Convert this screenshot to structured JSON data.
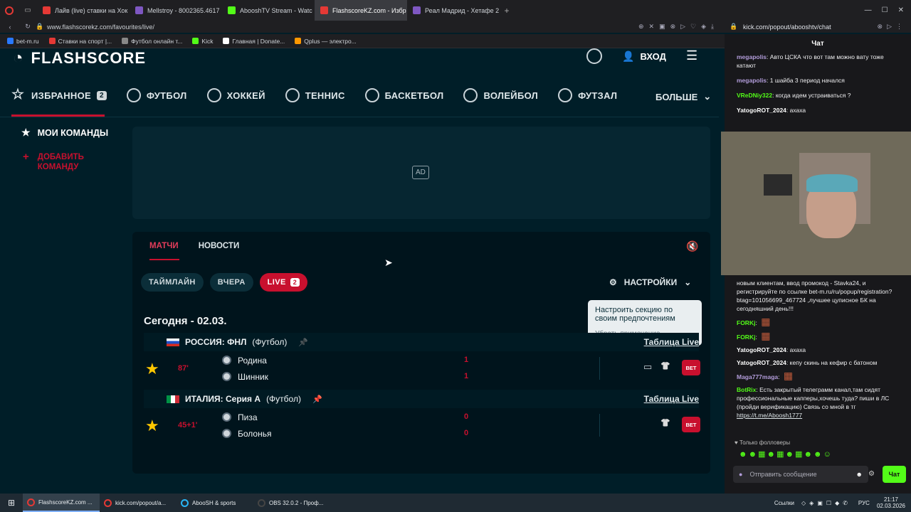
{
  "browser": {
    "tabs": [
      {
        "label": "Лайв (live) ставки на Хок",
        "color": "#e53935"
      },
      {
        "label": "Mellstroy - 8002365.4617",
        "color": "#7e57c2"
      },
      {
        "label": "AbooshTV Stream - Watc",
        "color": "#53fc18"
      },
      {
        "label": "FlashscoreKZ.com - Избр",
        "color": "#e53935"
      },
      {
        "label": "Реал Мадрид - Хетафе 2",
        "color": "#7e57c2"
      }
    ],
    "url": "www.flashscorekz.com/favourites/live/",
    "chat_url": "kick.com/popout/abooshtv/chat",
    "bookmarks": [
      {
        "label": "bet-m.ru",
        "color": "#2979ff"
      },
      {
        "label": "Ставки на спорт |...",
        "color": "#e53935"
      },
      {
        "label": "Футбол онлайн т...",
        "color": "#888888"
      },
      {
        "label": "Kick",
        "color": "#53fc18"
      },
      {
        "label": "Главная | Donate...",
        "color": "#ffffff"
      },
      {
        "label": "Qplus — электро...",
        "color": "#ff9800"
      }
    ]
  },
  "site": {
    "logo": "FLASHSCORE",
    "login": "ВХОД",
    "nav": [
      {
        "label": "ИЗБРАННОЕ",
        "badge": "2",
        "icon": "star-icon"
      },
      {
        "label": "ФУТБОЛ",
        "icon": "football-icon"
      },
      {
        "label": "ХОККЕЙ",
        "icon": "hockey-icon"
      },
      {
        "label": "ТЕННИС",
        "icon": "tennis-icon"
      },
      {
        "label": "БАСКЕТБОЛ",
        "icon": "basketball-icon"
      },
      {
        "label": "ВОЛЕЙБОЛ",
        "icon": "volleyball-icon"
      },
      {
        "label": "ФУТЗАЛ",
        "icon": "futsal-icon"
      }
    ],
    "more": "БОЛЬШЕ",
    "sidebar": {
      "my_teams": "МОИ КОМАНДЫ",
      "add_team": "ДОБАВИТЬ КОМАНДУ"
    },
    "ad_label": "AD",
    "tabs": [
      "МАТЧИ",
      "НОВОСТИ"
    ],
    "filters": [
      "ТАЙМЛАЙН",
      "ВЧЕРА",
      "LIVE"
    ],
    "live_count": "2",
    "settings": "НАСТРОЙКИ",
    "tooltip": {
      "text": "Настроить секцию по своим предпочтениям",
      "dismiss": "Убрать примечание"
    },
    "date": "Сегодня - 02.03.",
    "leagues": [
      {
        "name": "РОССИЯ: ФНЛ",
        "sport": "(Футбол)",
        "table": "Таблица Live",
        "match": {
          "minute": "87'",
          "home": "Родина",
          "away": "Шинник",
          "home_score": "1",
          "away_score": "1"
        }
      },
      {
        "name": "ИТАЛИЯ: Серия А",
        "sport": "(Футбол)",
        "table": "Таблица Live",
        "match": {
          "minute": "45+1'",
          "home": "Пиза",
          "away": "Болонья",
          "home_score": "0",
          "away_score": "0"
        }
      }
    ],
    "bet_label": "BET"
  },
  "chat": {
    "title": "Чат",
    "messages_top": [
      {
        "user": "megapolis",
        "text": "Авто ЦСКА что вот там можно вату тоже катают",
        "color": "#b39ddb"
      },
      {
        "user": "megapolis",
        "text": "1 шайба 3 период начался",
        "color": "#b39ddb"
      },
      {
        "user": "VReDNiy322",
        "text": "когда идем устраиваться ?",
        "color": "#53fc18"
      },
      {
        "user": "YatogoROT_2024",
        "text": "ахаха",
        "color": "#ffffff"
      }
    ],
    "messages_bottom": [
      {
        "user": "",
        "text": "новым клиентам, ввод промокод - Stavka24, и регистрируйте по ссылке bet-m.ru/ru/popup/registration?btag=101056699_467724 ,лучшее цуписное БК на сегодняшний день!!!",
        "color": "#ffffff"
      },
      {
        "user": "FORKj",
        "text": "",
        "color": "#53fc18"
      },
      {
        "user": "FORKj",
        "text": "",
        "color": "#53fc18"
      },
      {
        "user": "YatogoROT_2024",
        "text": "ахаха",
        "color": "#ffffff"
      },
      {
        "user": "YatogoROT_2024",
        "text": "кепу скинь на кефир с батоном",
        "color": "#ffffff"
      },
      {
        "user": "Maga777maga",
        "text": "",
        "color": "#b39ddb"
      },
      {
        "user": "BotRix",
        "text": "Есть закрытый телеграмм канал,там сидят профессиональные капперы,хочешь туда? пиши в ЛС (пройди верификацию) Связь со мной в тг ",
        "color": "#53fc18",
        "link": "https://t.me/Aboosh1777"
      }
    ],
    "followers_only": "Только фолловеры",
    "send_placeholder": "Отправить сообщение",
    "send_button": "Чат"
  },
  "taskbar": {
    "items": [
      {
        "label": "FlashscoreKZ.com ...",
        "color": "#e53935"
      },
      {
        "label": "kick.com/popout/a...",
        "color": "#e53935"
      },
      {
        "label": "AbooSH & sports",
        "color": "#29b6f6"
      },
      {
        "label": "OBS 32.0.2 - Проф...",
        "color": "#444444"
      }
    ],
    "links": "Ссылки",
    "lang": "РУС",
    "time": "21:17",
    "date": "02.03.2026"
  }
}
